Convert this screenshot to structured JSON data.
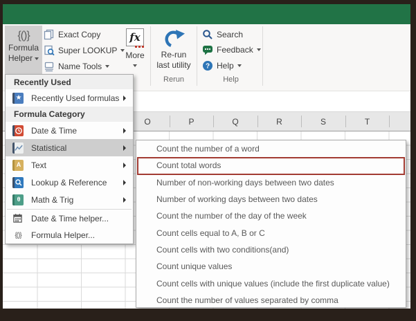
{
  "colors": {
    "excel_green": "#217346",
    "accent_blue": "#2e75b6",
    "kutools_navy": "#44546a",
    "highlight_red": "#a23b32",
    "menu_highlight_gray": "#cecece"
  },
  "ribbon": {
    "formula_helper": {
      "line1": "Formula",
      "line2": "Helper",
      "glyph": "{()}"
    },
    "exact_copy_label": "Exact Copy",
    "super_lookup_label": "Super LOOKUP",
    "name_tools_label": "Name Tools",
    "more": {
      "label": "More",
      "glyph": "fx"
    },
    "rerun": {
      "line1": "Re-run",
      "line2": "last utility",
      "group_label": "Rerun"
    },
    "help": {
      "search_label": "Search",
      "feedback_label": "Feedback",
      "help_label": "Help",
      "group_label": "Help",
      "question_glyph": "?"
    }
  },
  "sheet": {
    "columns": [
      "O",
      "P",
      "Q",
      "R",
      "S",
      "T"
    ]
  },
  "menu": {
    "section_recently_used": "Recently Used",
    "recently_used_item": "Recently Used formulas",
    "section_formula_category": "Formula Category",
    "categories": [
      "Date & Time",
      "Statistical",
      "Text",
      "Lookup & Reference",
      "Math & Trig"
    ],
    "highlighted_category": "Statistical",
    "date_time_helper_item": "Date & Time helper...",
    "formula_helper_item": "Formula Helper...",
    "glyph_star": "★",
    "glyph_a": "A",
    "glyph_theta": "θ",
    "glyph_braces": "{()}"
  },
  "submenu": {
    "items": [
      "Count the number of a word",
      "Count total words",
      "Number of non-working days between two dates",
      "Number of working days between two dates",
      "Count the number of the day of the week",
      "Count cells equal to A, B or C",
      "Count cells with two conditions(and)",
      "Count unique values",
      "Count cells with unique values (include the first duplicate value)",
      "Count the number of values separated by comma"
    ],
    "highlighted_item": "Count total words"
  }
}
